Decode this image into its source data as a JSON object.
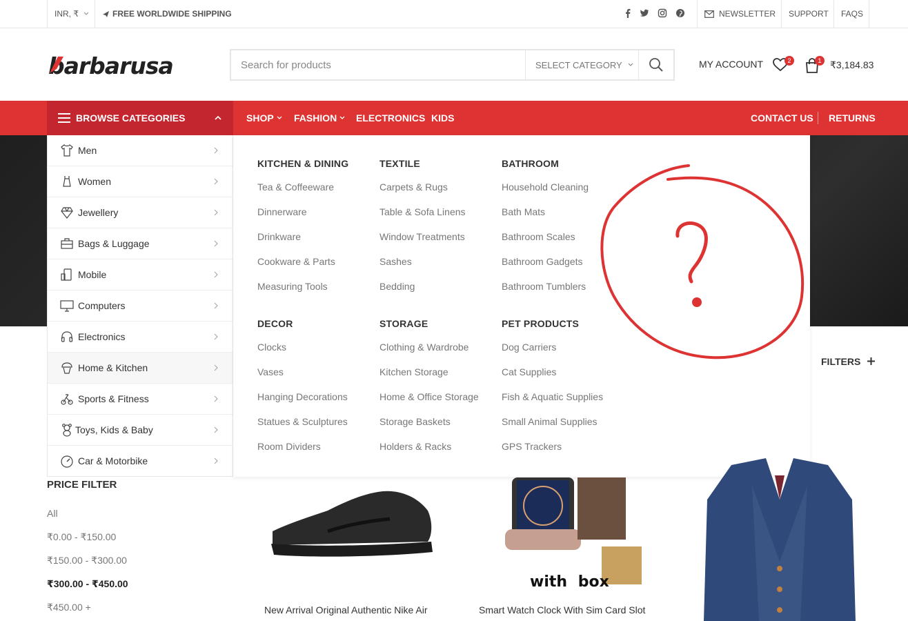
{
  "topbar": {
    "currency": "INR, ₹",
    "shipping": "FREE WORLDWIDE SHIPPING",
    "newsletter": "NEWSLETTER",
    "support": "SUPPORT",
    "faqs": "FAQS",
    "social_icons": [
      "facebook-icon",
      "twitter-icon",
      "instagram-icon",
      "pinterest-icon"
    ]
  },
  "header": {
    "logo": "barbarusa",
    "search_placeholder": "Search for products",
    "select_category": "SELECT CATEGORY",
    "my_account": "MY ACCOUNT",
    "wishlist_count": "2",
    "cart_count": "1",
    "cart_total": "₹3,184.83"
  },
  "nav": {
    "browse": "BROWSE CATEGORIES",
    "shop": "SHOP",
    "fashion": "FASHION",
    "electronics": "ELECTRONICS",
    "kids": "KIDS",
    "contact": "CONTACT US",
    "returns": "RETURNS"
  },
  "categories": [
    "Men",
    "Women",
    "Jewellery",
    "Bags & Luggage",
    "Mobile",
    "Computers",
    "Electronics",
    "Home & Kitchen",
    "Sports & Fitness",
    "Toys, Kids & Baby",
    "Car & Motorbike"
  ],
  "mega": {
    "kitchen": {
      "title": "KITCHEN & DINING",
      "items": [
        "Tea & Coffeeware",
        "Dinnerware",
        "Drinkware",
        "Cookware & Parts",
        "Measuring Tools"
      ]
    },
    "textile": {
      "title": "TEXTILE",
      "items": [
        "Carpets & Rugs",
        "Table & Sofa Linens",
        "Window Treatments",
        "Sashes",
        "Bedding"
      ]
    },
    "bathroom": {
      "title": "BATHROOM",
      "items": [
        "Household Cleaning",
        "Bath Mats",
        "Bathroom Scales",
        "Bathroom Gadgets",
        "Bathroom Tumblers"
      ]
    },
    "decor": {
      "title": "DECOR",
      "items": [
        "Clocks",
        "Vases",
        "Hanging Decorations",
        "Statues & Sculptures",
        "Room Dividers"
      ]
    },
    "storage": {
      "title": "STORAGE",
      "items": [
        "Clothing & Wardrobe",
        "Kitchen Storage",
        "Home & Office Storage",
        "Storage Baskets",
        "Holders & Racks"
      ]
    },
    "pet": {
      "title": "PET PRODUCTS",
      "items": [
        "Dog Carriers",
        "Cat Supplies",
        "Fish & Aquatic Supplies",
        "Small Animal Supplies",
        "GPS Trackers"
      ]
    }
  },
  "annotation": {
    "mark": "?",
    "color": "#dd3333"
  },
  "price_filter": {
    "title": "PRICE FILTER",
    "items": [
      "All",
      "₹0.00 - ₹150.00",
      "₹150.00 - ₹300.00",
      "₹300.00 - ₹450.00",
      "₹450.00 +"
    ]
  },
  "filters_label": "FILTERS",
  "products": [
    {
      "title": "New Arrival Original Authentic Nike Air"
    },
    {
      "title": "Smart Watch Clock With Sim Card Slot",
      "box_text": "with box"
    }
  ],
  "colors": {
    "accent": "#dd3333",
    "accent_dark": "#c4262f"
  }
}
